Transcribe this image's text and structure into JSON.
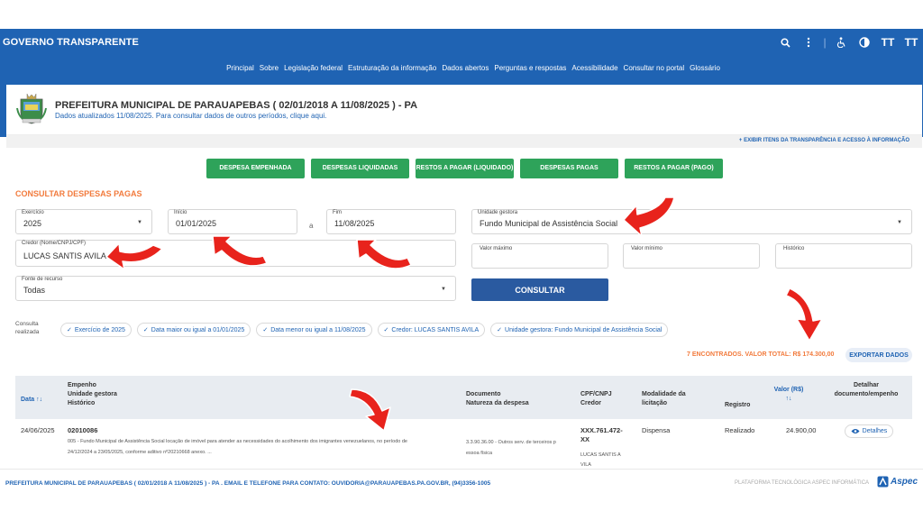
{
  "header": {
    "brand": "GOVERNO TRANSPARENTE",
    "tools": {
      "text_size": "TT",
      "text_size2": "TT"
    },
    "nav": [
      "Principal",
      "Sobre",
      "Legislação federal",
      "Estruturação da informação",
      "Dados abertos",
      "Perguntas e respostas",
      "Acessibilidade",
      "Consultar no portal",
      "Glossário"
    ]
  },
  "entity": {
    "title": "PREFEITURA MUNICIPAL DE PARAUAPEBAS ( 02/01/2018 A 11/08/2025 ) - PA",
    "subtitle": "Dados atualizados 11/08/2025. Para consultar dados de outros períodos, clique aqui.",
    "exibir": "+ EXIBIR ITENS DA TRANSPARÊNCIA E ACESSO À INFORMAÇÃO"
  },
  "tabs": [
    "DESPESA EMPENHADA",
    "DESPESAS LIQUIDADAS",
    "RESTOS A PAGAR (LIQUIDADO)",
    "DESPESAS PAGAS",
    "RESTOS A PAGAR (PAGO)"
  ],
  "form": {
    "section_title": "CONSULTAR DESPESAS PAGAS",
    "exercicio": {
      "label": "Exercício",
      "value": "2025"
    },
    "inicio": {
      "label": "Início",
      "value": "01/01/2025"
    },
    "separator": "a",
    "fim": {
      "label": "Fim",
      "value": "11/08/2025"
    },
    "unidade": {
      "label": "Unidade gestora",
      "value": "Fundo Municipal de Assistência Social"
    },
    "credor": {
      "label": "Credor (Nome/CNPJ/CPF)",
      "value": "LUCAS SANTIS AVILA"
    },
    "valor_max": {
      "label": "Valor máximo"
    },
    "valor_min": {
      "label": "Valor mínimo"
    },
    "historico": {
      "label": "Histórico"
    },
    "fonte": {
      "label": "Fonte de recurso",
      "value": "Todas"
    },
    "consultar": "CONSULTAR"
  },
  "consulta": {
    "label": "Consulta realizada",
    "chips": [
      "Exercício de 2025",
      "Data maior ou igual a 01/01/2025",
      "Data menor ou igual a 11/08/2025",
      "Credor: LUCAS SANTIS AVILA",
      "Unidade gestora: Fundo Municipal de Assistência Social"
    ]
  },
  "results": {
    "summary": "7 ENCONTRADOS. VALOR TOTAL: R$ 174.300,00",
    "export": "EXPORTAR DADOS"
  },
  "table": {
    "headers": {
      "data": "Data",
      "empenho": "Empenho",
      "unidade": "Unidade gestora",
      "historico": "Histórico",
      "documento": "Documento",
      "natureza": "Natureza da despesa",
      "cpf": "CPF/CNPJ",
      "credor": "Credor",
      "modalidade1": "Modalidade da",
      "modalidade2": "licitação",
      "registro": "Registro",
      "valor": "Valor (R$)",
      "detalhar1": "Detalhar",
      "detalhar2": "documento/empenho"
    },
    "row": {
      "data": "24/06/2025",
      "empenho": "02010086",
      "hist1": "005 - Fundo Municipal de Assistência Social locação de imóvel para atender as necessidades do acolhimento dos imigrantes venezuelanos, no período de",
      "hist2": "24/12/2024 a 23/05/2025, conforme aditivo nº20210668 anexo. ...",
      "nat1": "3.3.90.36.00 - Outros serv. de terceiros p",
      "nat2": "essoa física",
      "cpf1": "XXX.761.472-",
      "cpf2": "XX",
      "credor1": "LUCAS SANTIS A",
      "credor2": "VILA",
      "modalidade": "Dispensa",
      "registro": "Realizado",
      "valor": "24.900,00",
      "detalhes": "Detalhes"
    }
  },
  "footer": {
    "left": "PREFEITURA MUNICIPAL DE PARAUAPEBAS ( 02/01/2018 A 11/08/2025 ) - PA . EMAIL E TELEFONE PARA CONTATO: OUVIDORIA@PARAUAPEBAS.PA.GOV.BR, (94)3356-1005",
    "right": "PLATAFORMA TECNOLÓGICA ASPEC INFORMÁTICA",
    "logo": "Aspec"
  },
  "colors": {
    "primary": "#1f63b3",
    "green": "#2ea35a",
    "orange": "#f27b3d",
    "arrow": "#e8231c"
  }
}
